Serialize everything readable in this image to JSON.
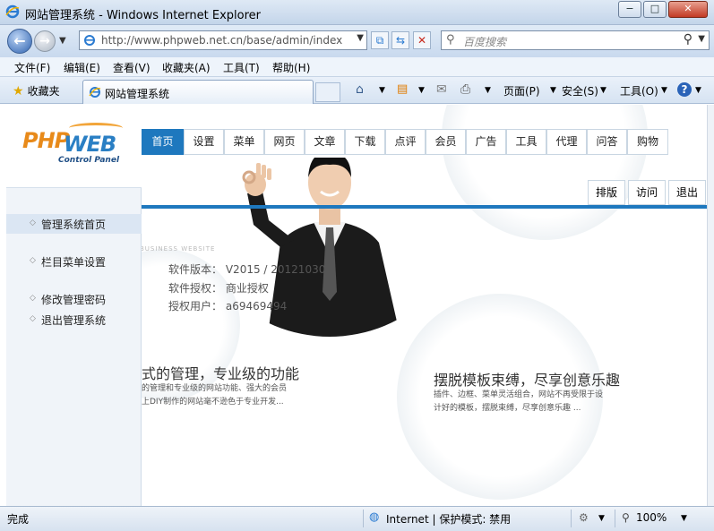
{
  "window": {
    "title": "网站管理系统 - Windows Internet Explorer",
    "controls": {
      "minimize": "−",
      "maximize": "□",
      "close": "✕"
    }
  },
  "address": {
    "url": "http://www.phpweb.net.cn/base/admin/index.ph",
    "search_placeholder": "百度搜索"
  },
  "menu": [
    "文件(F)",
    "编辑(E)",
    "查看(V)",
    "收藏夹(A)",
    "工具(T)",
    "帮助(H)"
  ],
  "favorites": {
    "label": "收藏夹",
    "tab_title": "网站管理系统"
  },
  "commandbar": {
    "page": "页面(P)",
    "safety": "安全(S)",
    "tools": "工具(O)"
  },
  "logo": {
    "php": "PHP",
    "web": "WEB",
    "sub": "Control Panel"
  },
  "left_menu": [
    {
      "label": "管理系统首页",
      "active": true
    },
    {
      "label": "栏目菜单设置",
      "active": false
    },
    {
      "label": "修改管理密码",
      "active": false
    },
    {
      "label": "退出管理系统",
      "active": false
    }
  ],
  "top_nav": [
    "首页",
    "设置",
    "菜单",
    "网页",
    "文章",
    "下载",
    "点评",
    "会员",
    "广告",
    "工具",
    "代理",
    "问答",
    "购物"
  ],
  "sub_nav": [
    "排版",
    "访问",
    "退出"
  ],
  "banner": {
    "watermark": "BUSINESS WEBSITE",
    "version_label": "软件版本：",
    "version_value": "V2015 / 20121030",
    "license_label": "软件授权：",
    "license_value": "商业授权",
    "user_label": "授权用户：",
    "user_value": "a69469494",
    "left_title": "式的管理，专业级的功能",
    "left_desc1": "的管理和专业级的网站功能、强大的会员",
    "left_desc2": "上DIY制作的网站毫不逊色于专业开发...",
    "right_title": "摆脱模板束缚，尽享创意乐趣",
    "right_desc1": "插件、边框、菜单灵活组合，网站不再受限于设",
    "right_desc2": "计好的模板，摆脱束缚，尽享创意乐趣 ..."
  },
  "status": {
    "text": "完成",
    "zone": "Internet | 保护模式: 禁用",
    "zoom": "100%"
  },
  "colors": {
    "accent": "#1e78be",
    "logo_orange": "#e88a1a",
    "logo_blue": "#2a7fc4"
  }
}
